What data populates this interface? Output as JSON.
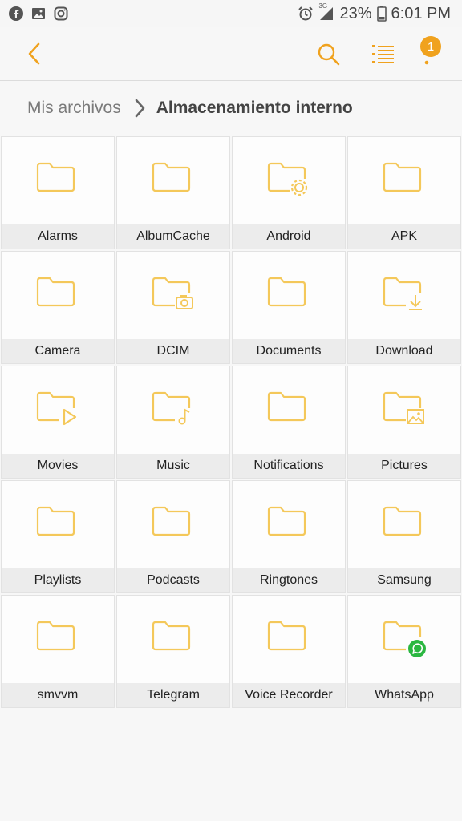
{
  "status_bar": {
    "battery": "23%",
    "time": "6:01 PM",
    "network": "3G"
  },
  "breadcrumb": {
    "root": "Mis archivos",
    "current": "Almacenamiento interno"
  },
  "toolbar": {
    "notification_count": "1"
  },
  "colors": {
    "accent": "#f0a21e",
    "folder_stroke": "#f4c85a"
  },
  "folders": [
    {
      "label": "Alarms",
      "icon": "folder-icon"
    },
    {
      "label": "AlbumCache",
      "icon": "folder-icon"
    },
    {
      "label": "Android",
      "icon": "folder-settings-icon"
    },
    {
      "label": "APK",
      "icon": "folder-icon"
    },
    {
      "label": "Camera",
      "icon": "folder-icon"
    },
    {
      "label": "DCIM",
      "icon": "folder-camera-icon"
    },
    {
      "label": "Documents",
      "icon": "folder-icon"
    },
    {
      "label": "Download",
      "icon": "folder-download-icon"
    },
    {
      "label": "Movies",
      "icon": "folder-play-icon"
    },
    {
      "label": "Music",
      "icon": "folder-music-icon"
    },
    {
      "label": "Notifications",
      "icon": "folder-icon"
    },
    {
      "label": "Pictures",
      "icon": "folder-image-icon"
    },
    {
      "label": "Playlists",
      "icon": "folder-icon"
    },
    {
      "label": "Podcasts",
      "icon": "folder-icon"
    },
    {
      "label": "Ringtones",
      "icon": "folder-icon"
    },
    {
      "label": "Samsung",
      "icon": "folder-icon"
    },
    {
      "label": "smvvm",
      "icon": "folder-icon"
    },
    {
      "label": "Telegram",
      "icon": "folder-icon"
    },
    {
      "label": "Voice Recorder",
      "icon": "folder-icon"
    },
    {
      "label": "WhatsApp",
      "icon": "folder-whatsapp-icon"
    }
  ]
}
